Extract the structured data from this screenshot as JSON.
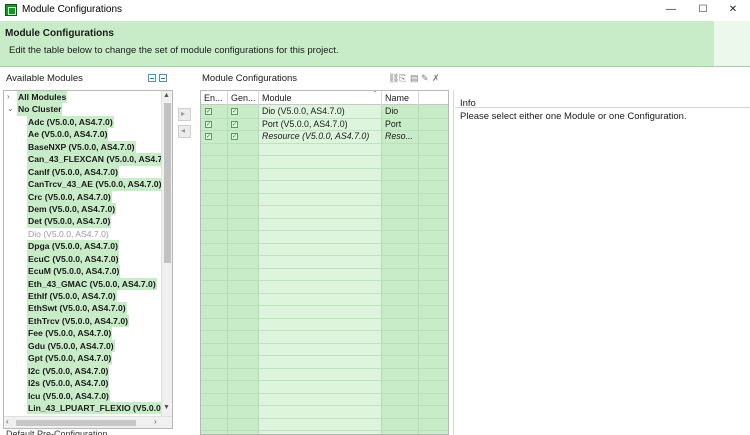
{
  "window": {
    "title": "Module Configurations",
    "minimize": "—",
    "maximize": "☐",
    "close": "✕"
  },
  "banner": {
    "title": "Module Configurations",
    "description": "Edit the table below to change the set of module configurations for this project."
  },
  "available_modules": {
    "label": "Available Modules",
    "top_items": [
      {
        "label": "All Modules",
        "twisty": "›"
      },
      {
        "label": "No Cluster",
        "twisty": "⌄"
      }
    ],
    "items": [
      {
        "label": "Adc (V5.0.0, AS4.7.0)"
      },
      {
        "label": "Ae (V5.0.0, AS4.7.0)"
      },
      {
        "label": "BaseNXP (V5.0.0, AS4.7.0)"
      },
      {
        "label": "Can_43_FLEXCAN (V5.0.0, AS4.7"
      },
      {
        "label": "CanIf (V5.0.0, AS4.7.0)"
      },
      {
        "label": "CanTrcv_43_AE (V5.0.0, AS4.7.0)"
      },
      {
        "label": "Crc (V5.0.0, AS4.7.0)"
      },
      {
        "label": "Dem (V5.0.0, AS4.7.0)"
      },
      {
        "label": "Det (V5.0.0, AS4.7.0)"
      },
      {
        "label": "Dio (V5.0.0, AS4.7.0)",
        "dim": true
      },
      {
        "label": "Dpga (V5.0.0, AS4.7.0)"
      },
      {
        "label": "EcuC (V5.0.0, AS4.7.0)"
      },
      {
        "label": "EcuM (V5.0.0, AS4.7.0)"
      },
      {
        "label": "Eth_43_GMAC (V5.0.0, AS4.7.0)"
      },
      {
        "label": "EthIf (V5.0.0, AS4.7.0)"
      },
      {
        "label": "EthSwt (V5.0.0, AS4.7.0)"
      },
      {
        "label": "EthTrcv (V5.0.0, AS4.7.0)"
      },
      {
        "label": "Fee (V5.0.0, AS4.7.0)"
      },
      {
        "label": "Gdu (V5.0.0, AS4.7.0)"
      },
      {
        "label": "Gpt (V5.0.0, AS4.7.0)"
      },
      {
        "label": "I2c (V5.0.0, AS4.7.0)"
      },
      {
        "label": "I2s (V5.0.0, AS4.7.0)"
      },
      {
        "label": "Icu (V5.0.0, AS4.7.0)"
      },
      {
        "label": "Lin_43_LPUART_FLEXIO (V5.0.0,"
      }
    ],
    "bottom_partial": "Default Pre-Configuration"
  },
  "module_configurations": {
    "label": "Module Configurations",
    "columns": [
      "En...",
      "Gen...",
      "Module",
      "Name"
    ],
    "rows": [
      {
        "enabled": "✓",
        "generate": "✓",
        "module": "Dio (V5.0.0, AS4.7.0)",
        "name": "Dio",
        "italic": false
      },
      {
        "enabled": "✓",
        "generate": "✓",
        "module": "Port (V5.0.0, AS4.7.0)",
        "name": "Port",
        "italic": false
      },
      {
        "enabled": "✓",
        "generate": "✓",
        "module": "Resource (V5.0.0, AS4.7.0)",
        "name": "Reso...",
        "italic": true
      }
    ]
  },
  "info": {
    "label": "Info",
    "text": "Please select either one Module or one Configuration."
  },
  "icons": {
    "app": "app-icon",
    "expand_all": "expand-all-icon",
    "collapse_all": "collapse-all-icon",
    "add": "add-config-icon",
    "remove": "remove-config-icon"
  },
  "colors": {
    "accent_green": "#c8ecc8",
    "module_column": "#dcf5dc"
  }
}
